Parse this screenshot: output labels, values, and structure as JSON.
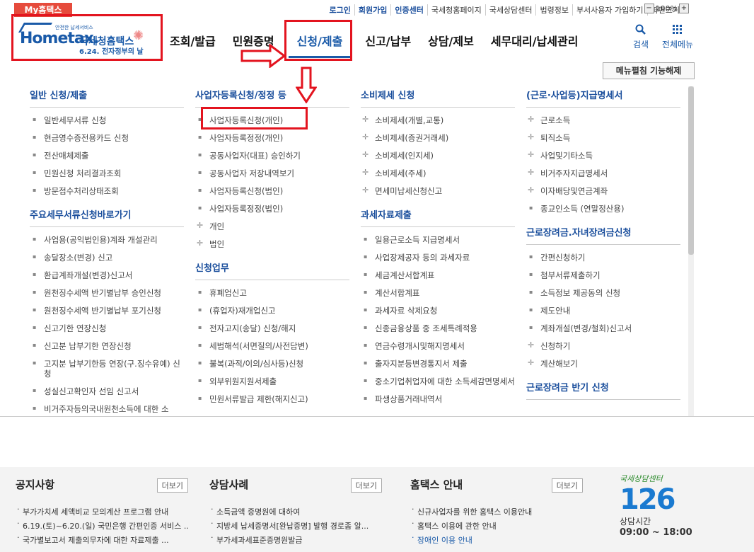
{
  "topbar": {
    "my_tab": "My홈택스",
    "links": [
      "로그인",
      "회원가입",
      "인증센터",
      "국세청홈페이지",
      "국세상담센터",
      "법령정보",
      "부서사용자 가입하기",
      "화면크기"
    ],
    "zoom": "100%"
  },
  "logo": {
    "small_text": "안전한 납세서비스",
    "brand": "Hometax.",
    "nts": "국세청홈택스",
    "slogan": "6.24. 전자정부의 날"
  },
  "nav": {
    "items": [
      "조회/발급",
      "민원증명",
      "신청/제출",
      "신고/납부",
      "상담/제보",
      "세무대리/납세관리"
    ],
    "search": "검색",
    "all_menu": "전체메뉴",
    "menu_close": "메뉴펼침 기능해제"
  },
  "mega": {
    "col1": [
      {
        "title": "일반 신청/제출",
        "items": [
          "일반세무서류 신청",
          "현금영수증전용카드 신청",
          "전산매체제출",
          "민원신청 처리결과조회",
          "방문접수처리상태조회"
        ]
      },
      {
        "title": "주요세무서류신청바로가기",
        "items": [
          "사업용(공익법인용)계좌 개설관리",
          "송달장소(변경) 신고",
          "환급계좌개설(변경)신고서",
          "원천징수세액 반기별납부 승인신청",
          "원천징수세액 반기별납부 포기신청",
          "신고기한 연장신청",
          "신고분 납부기한 연장신청",
          "고지분 납부기한등 연장(구.징수유예) 신청",
          "성실신고확인자 선임 신고서",
          "비거주자등의국내원천소득에 대한 소"
        ]
      }
    ],
    "col2": [
      {
        "title": "사업자등록신청/정정 등",
        "items": [
          "사업자등록신청(개인)",
          "사업자등록정정(개인)",
          "공동사업자(대표) 승인하기",
          "공동사업자 저장내역보기",
          "사업자등록신청(법인)",
          "사업자등록정정(법인)"
        ],
        "plus": [
          "개인",
          "법인"
        ]
      },
      {
        "title": "신청업무",
        "items": [
          "휴폐업신고",
          "(휴업자)재개업신고",
          "전자고지(송달) 신청/해지",
          "세법해석(서면질의/사전답변)",
          "불복(과적/이의/심사등)신청",
          "외부위원지원서제출",
          "민원서류발급 제한(해지신고)"
        ]
      }
    ],
    "col3": [
      {
        "title": "소비제세 신청",
        "plus": [
          "소비제세(개별,교통)",
          "소비제세(증권거래세)",
          "소비제세(인지세)",
          "소비제세(주세)",
          "면세미납세신청신고"
        ]
      },
      {
        "title": "과세자료제출",
        "items": [
          "일용근로소득 지급명세서",
          "사업장제공자 등의 과세자료",
          "세금계산서합계표",
          "계산서합계표",
          "과세자료 삭제요청",
          "신종금융상품 중 조세특례적용",
          "연금수령개시및해지명세서",
          "출자지분등변경통지서 제출",
          "중소기업취업자에 대한 소득세감면명세서",
          "파생상품거래내역서"
        ]
      }
    ],
    "col4": [
      {
        "title": "(근로·사업등)지급명세서",
        "plus": [
          "근로소득",
          "퇴직소득",
          "사업및기타소득",
          "비거주자지급명세서",
          "이자배당및연금계좌"
        ],
        "items": [
          "종교인소득 (연말정산용)"
        ]
      },
      {
        "title": "근로장려금.자녀장려금신청",
        "items": [
          "간편신청하기",
          "첨부서류제출하기",
          "소득정보 제공동의 신청",
          "제도안내",
          "계좌개설(변경/철회)신고서"
        ],
        "plus": [
          "신청하기",
          "계산해보기"
        ]
      },
      {
        "title": "근로장려금 반기 신청",
        "items": []
      }
    ]
  },
  "bottom": {
    "notice": {
      "title": "공지사항",
      "more": "더보기",
      "items": [
        "부가가치세 세액비교 모의계산 프로그램 안내",
        "6.19.(토)~6.20.(일) 국민은행 간편인증 서비스 ...",
        "국가별보고서 제출의무자에 대한 자료제출 ..."
      ]
    },
    "counsel": {
      "title": "상담사례",
      "more": "더보기",
      "items": [
        "소득금액 증명원에 대하여",
        "지방세 납세증명서[완납증명] 발행 경로좀 알...",
        "부가세과세표준증명원발급"
      ]
    },
    "guide": {
      "title": "홈택스 안내",
      "more": "더보기",
      "items": [
        "신규사업자를 위한 홈택스 이용안내",
        "홈택스 이용에 관한 안내",
        "장애인 이용 안내"
      ]
    },
    "callcenter": {
      "label": "국세상담센터",
      "number": "126",
      "hours_label": "상담시간",
      "hours": "09:00 ~ 18:00"
    }
  },
  "colors": {
    "brand_blue": "#1a5aa8",
    "annotation_red": "#e3141f",
    "my_tab": "#e64b3c"
  }
}
